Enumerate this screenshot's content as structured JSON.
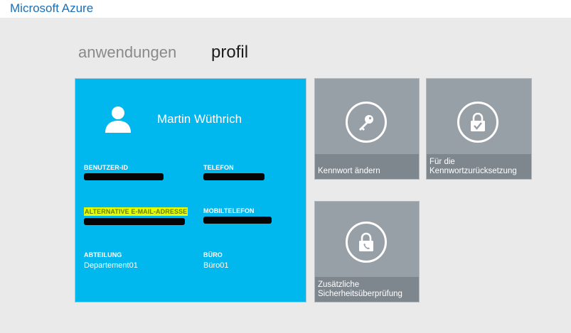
{
  "header": {
    "brand": "Microsoft Azure"
  },
  "nav": {
    "tabs": [
      {
        "label": "anwendungen"
      },
      {
        "label": "profil"
      }
    ]
  },
  "profile_card": {
    "user_icon": "person-icon",
    "name": "Martin Wüthrich",
    "fields": {
      "user_id": {
        "label": "BENUTZER-ID"
      },
      "phone": {
        "label": "TELEFON"
      },
      "alt_email": {
        "label": "ALTERNATIVE E-MAIL-ADRESSE"
      },
      "mobile": {
        "label": "MOBILTELEFON"
      },
      "department": {
        "label": "ABTEILUNG",
        "value": "Departement01"
      },
      "office": {
        "label": "BÜRO",
        "value": "Büro01"
      }
    },
    "colors": {
      "background": "#00b8ee",
      "highlight": "#e3ff00"
    }
  },
  "tiles": {
    "change_password": {
      "label": "Kennwort ändern",
      "icon": "key-icon"
    },
    "password_reset": {
      "label": "Für die\nKennwortzurücksetzung",
      "icon": "lock-check-icon"
    },
    "additional_verification": {
      "label": "Zusätzliche\nSicherheitsüberprüfung",
      "icon": "lock-phone-icon"
    }
  }
}
